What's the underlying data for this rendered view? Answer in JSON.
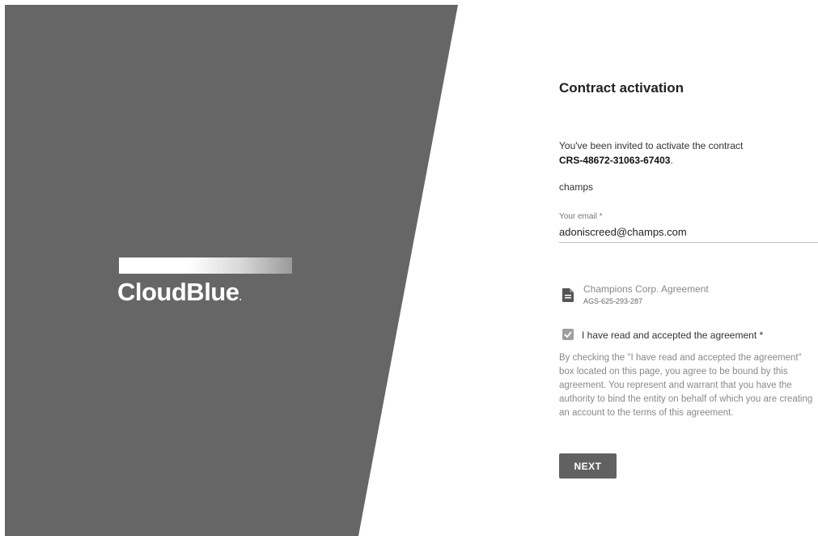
{
  "brand": {
    "logo_text": "CloudBlue",
    "logo_suffix": "."
  },
  "form": {
    "title": "Contract activation",
    "invite_text": "You've been invited to activate the contract",
    "contract_id": "CRS-48672-31063-67403",
    "contract_id_suffix": ".",
    "company": "champs",
    "email_label": "Your email *",
    "email_value": "adoniscreed@champs.com",
    "agreement": {
      "icon": "document-icon",
      "name": "Champions Corp. Agreement",
      "id": "AGS-625-293-287"
    },
    "checkbox": {
      "checked": true,
      "label": "I have read and accepted the agreement *"
    },
    "terms_text": "By checking the \"I have read and accepted the agreement\" box located on this page, you agree to be bound by this agreement. You represent and warrant that you have the authority to bind the entity on behalf of which you are creating an account to the terms of this agreement.",
    "next_label": "NEXT"
  },
  "colors": {
    "panel": "#666666",
    "button": "#616161",
    "checkbox": "#9e9e9e"
  }
}
